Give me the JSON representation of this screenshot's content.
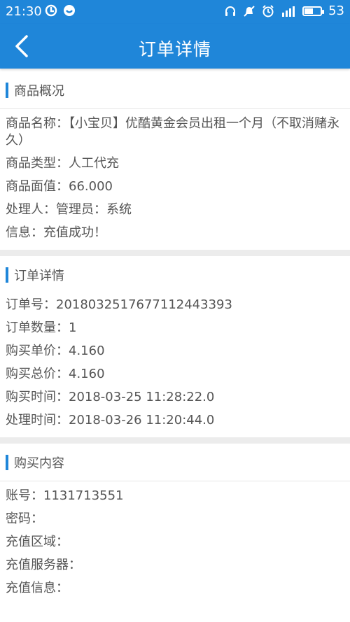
{
  "status_bar": {
    "time": "21:30",
    "battery": "53",
    "battery_level": 0.53,
    "left_icons": [
      "sync-icon",
      "app-icon"
    ],
    "right_icons": [
      "headset-icon",
      "mute-icon",
      "alarm-icon",
      "signal-4g-icon",
      "battery-icon"
    ]
  },
  "nav": {
    "title": "订单详情",
    "back_icon": "chevron-left-icon"
  },
  "colors": {
    "accent": "#1f86d9",
    "divider": "#ececec"
  },
  "product_section": {
    "title": "商品概况",
    "rows": [
      "商品名称：【小宝贝】优酷黄金会员出租一个月（不取消赌永久）",
      "商品类型：人工代充",
      "商品面值：66.000",
      "处理人：管理员：系统",
      "信息：充值成功！"
    ]
  },
  "order_section": {
    "title": "订单详情",
    "rows": [
      "订单号：2018032517677112443393",
      "订单数量：1",
      "购买单价：4.160",
      "购买总价：4.160",
      "购买时间：2018-03-25 11:28:22.0",
      "处理时间：2018-03-26 11:20:44.0"
    ]
  },
  "purchase_section": {
    "title": "购买内容",
    "rows": [
      "账号：1131713551",
      "密码：",
      "充值区域：",
      "充值服务器：",
      "充值信息："
    ]
  }
}
